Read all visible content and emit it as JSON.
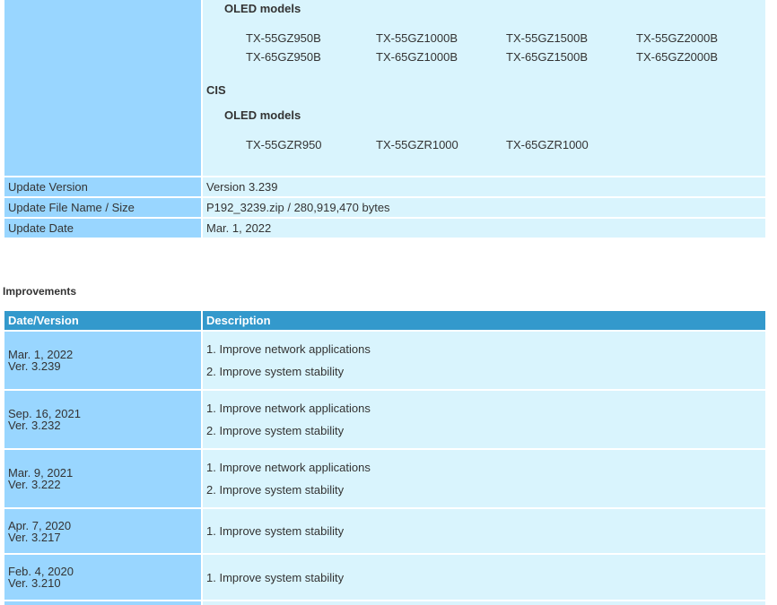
{
  "spec": {
    "models_block": {
      "group1_heading": "OLED models",
      "group1_models": [
        "TX-55GZ950B",
        "TX-55GZ1000B",
        "TX-55GZ1500B",
        "TX-55GZ2000B",
        "TX-65GZ950B",
        "TX-65GZ1000B",
        "TX-65GZ1500B",
        "TX-65GZ2000B"
      ],
      "region": "CIS",
      "group2_heading": "OLED models",
      "group2_models": [
        "TX-55GZR950",
        "TX-55GZR1000",
        "TX-65GZR1000"
      ]
    },
    "update_version_label": "Update Version",
    "update_version_value": "Version 3.239",
    "file_label": "Update File Name / Size",
    "file_value": "P192_3239.zip / 280,919,470 bytes",
    "date_label": "Update Date",
    "date_value": "Mar. 1, 2022"
  },
  "improvements": {
    "title": "Improvements",
    "col_date": "Date/Version",
    "col_desc": "Description",
    "rows": [
      {
        "date": "Mar. 1, 2022",
        "version": "Ver. 3.239",
        "items": [
          "1. Improve network applications",
          "2. Improve system stability"
        ]
      },
      {
        "date": "Sep. 16, 2021",
        "version": "Ver. 3.232",
        "items": [
          "1. Improve network applications",
          "2. Improve system stability"
        ]
      },
      {
        "date": "Mar. 9, 2021",
        "version": "Ver. 3.222",
        "items": [
          "1. Improve network applications",
          "2. Improve system stability"
        ]
      },
      {
        "date": "Apr. 7, 2020",
        "version": "Ver. 3.217",
        "items": [
          "1. Improve system stability"
        ]
      },
      {
        "date": "Feb. 4, 2020",
        "version": "Ver. 3.210",
        "items": [
          "1. Improve system stability"
        ]
      }
    ]
  },
  "colors": {
    "label_cell": "#99d6ff",
    "value_cell": "#d9f4fd",
    "header_cell": "#3399cc"
  }
}
